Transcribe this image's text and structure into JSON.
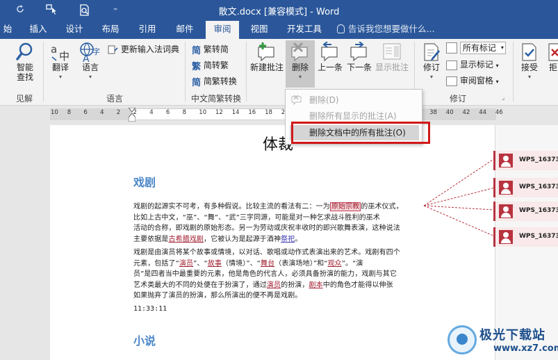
{
  "window": {
    "title": "散文.docx [兼容模式] - Word",
    "quick_access": {
      "redo_icon": "redo-icon",
      "touch_icon": "touch-mode-icon",
      "preview_icon": "print-preview-icon"
    }
  },
  "tabs": {
    "items": [
      "始",
      "插入",
      "设计",
      "布局",
      "引用",
      "邮件",
      "审阅",
      "视图",
      "开发工具"
    ],
    "active": "审阅",
    "tell_me": "告诉我您想要做什么..."
  },
  "ribbon": {
    "proofing": {
      "smart_lookup": "智能\n查找",
      "group_label": "见解"
    },
    "language": {
      "translate": "翻译",
      "language": "语言",
      "update_ime": "更新输入法词典",
      "group_label": "语言"
    },
    "chinese": {
      "to_simplified": "繁转简",
      "to_traditional": "简转繁",
      "convert": "简繁转换",
      "group_label": "中文简繁转换"
    },
    "comments": {
      "new": "新建批注",
      "delete": "删除",
      "previous": "上一条",
      "next": "下一条",
      "show": "显示批注"
    },
    "tracking": {
      "track": "修订",
      "markup_mode": "所有标记",
      "show_markup": "显示标记",
      "reviewing_pane": "审阅窗格",
      "group_label": "修订"
    },
    "changes": {
      "accept": "接受",
      "reject": "拒"
    }
  },
  "ruler": {
    "ticks": [
      "10",
      "8",
      "6",
      "4",
      "2",
      "2",
      "4",
      "6",
      "8",
      "10",
      "12",
      "14",
      "16",
      "18",
      "20",
      "22",
      "24",
      "26",
      "28",
      "30",
      "32",
      "34",
      "36",
      "38",
      "40",
      "42",
      "44",
      "46"
    ]
  },
  "dropdown": {
    "items": [
      "删除(D)",
      "删除所有显示的批注(A)",
      "删除文档中的所有批注(O)"
    ],
    "highlighted": 2
  },
  "document": {
    "title": "体裁",
    "heading1": "戏剧",
    "heading2": "小说",
    "timestamp": "11:33:11",
    "p1": {
      "l1a": "戏剧的起源实不可考，有多种假说。比较主流的看法有二：一为",
      "l1b": "原始宗教",
      "l1c": "的巫术仪式，",
      "l2": "比如上古中文，“巫”、“舞”、“武”三字同源，可能是对一种乞求战斗胜利的巫术",
      "l3": "活动的合称，即戏剧的原始形态。另一为劳动或庆祝丰收时的即兴歌舞表演，这种说法",
      "l4a": "主要依据是",
      "l4b": "古希腊戏剧",
      "l4c": "，它被认为是起源于酒神",
      "l4d": "祭祀",
      "l4e": "。"
    },
    "p2": {
      "l1": "戏剧是由演员将某个故事或情境，以对话、歌唱或动作式表演出来的艺术。戏剧有四个",
      "l2a": "元素，包括了“",
      "l2b": "演员",
      "l2c": "”、“",
      "l2d": "故事",
      "l2e": "（情境）”、“",
      "l2f": "舞台",
      "l2g": "（表演场地）”和“",
      "l2h": "观众",
      "l2i": "”。“演",
      "l3": "员”是四者当中最重要的元素，他是角色的代言人，必须具备扮演的能力，戏剧与其它",
      "l4a": "艺术类最大的不同的处便在于扮演了，通过",
      "l4b": "演员",
      "l4c": "的扮演，",
      "l4d": "剧本",
      "l4e": "中的角色才能得以伸张",
      "l5": "如果抛弃了演员的扮演，那么所演出的便不再是戏剧。"
    }
  },
  "comments": {
    "authors": [
      "WPS_16373265",
      "WPS_16373265",
      "WPS_16373265",
      "WPS_16373265"
    ]
  },
  "watermark": {
    "title": "极光下载站",
    "url": "www.xz7.com"
  },
  "colors": {
    "accent": "#2b579a",
    "comment": "#b8333f",
    "highlight_frame": "#d01818",
    "heading": "#4a86c8"
  }
}
